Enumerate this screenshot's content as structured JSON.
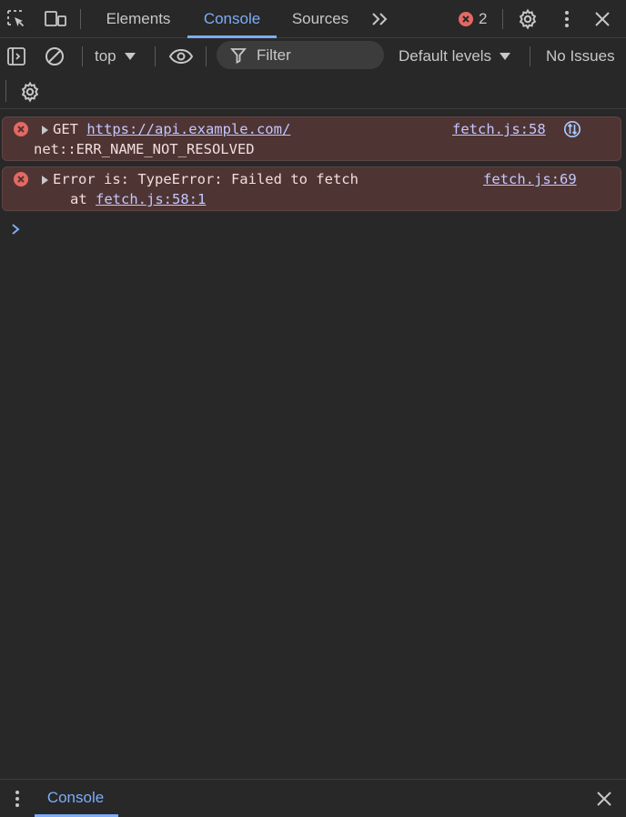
{
  "tabs": {
    "elements": "Elements",
    "console": "Console",
    "sources": "Sources",
    "error_count": "2"
  },
  "toolbar": {
    "context": "top",
    "filter_placeholder": "Filter",
    "levels": "Default levels",
    "issues": "No Issues"
  },
  "messages": [
    {
      "prefix": "GET ",
      "url": "https://api.example.com/",
      "source": "fetch.js:58",
      "detail": "net::ERR_NAME_NOT_RESOLVED"
    },
    {
      "text": "Error is: TypeError: Failed to fetch",
      "source": "fetch.js:69",
      "stack_prefix": "at ",
      "stack_link": "fetch.js:58:1"
    }
  ],
  "drawer": {
    "tab": "Console"
  },
  "colors": {
    "accent": "#7cacf8",
    "error_bg": "#4e3534",
    "error_icon": "#e46962"
  }
}
